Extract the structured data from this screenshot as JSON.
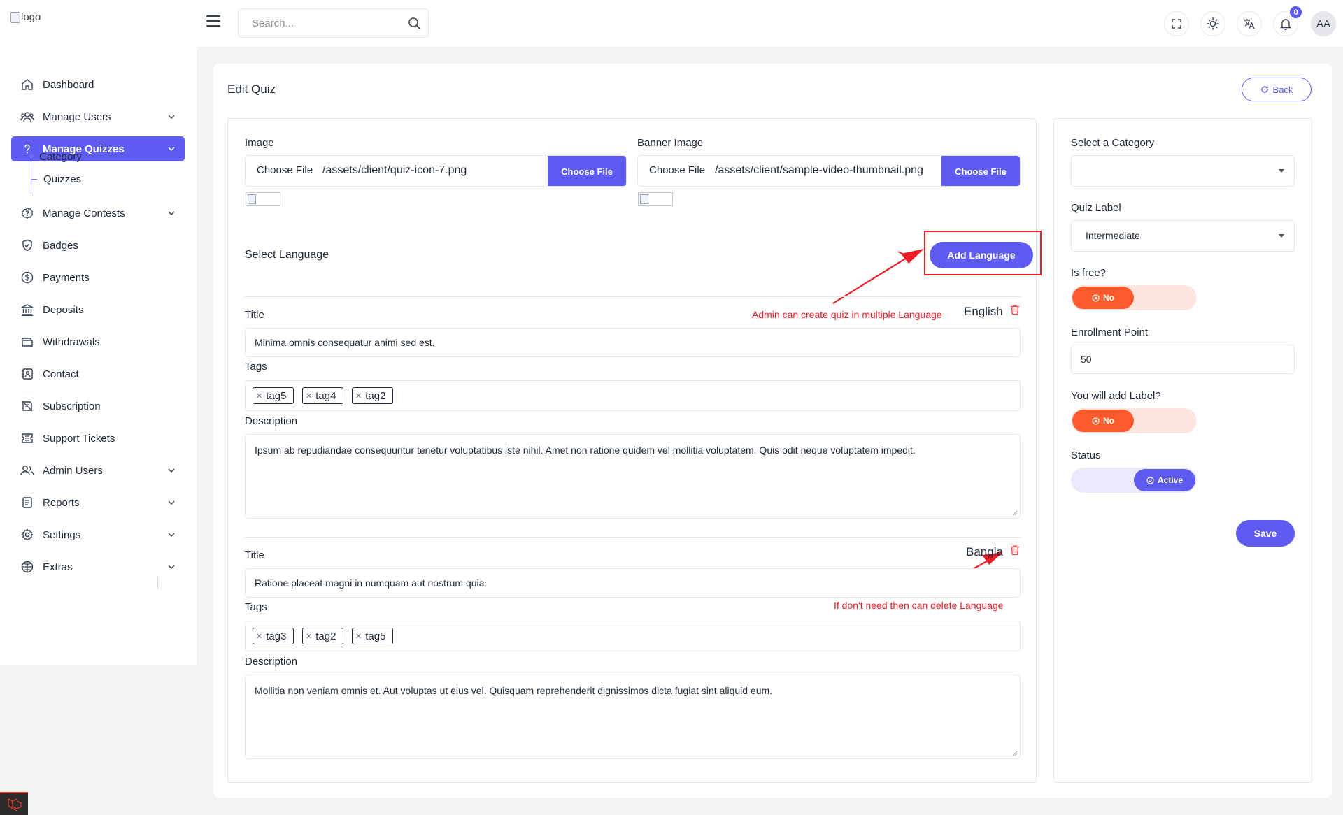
{
  "header": {
    "logo_alt": "logo",
    "search_placeholder": "Search...",
    "notification_count": "0",
    "avatar_initials": "AA"
  },
  "sidebar": {
    "items": [
      {
        "label": "Dashboard",
        "icon": "home-icon",
        "has_chevron": false
      },
      {
        "label": "Manage Users",
        "icon": "users-icon",
        "has_chevron": true
      },
      {
        "label": "Manage Quizzes",
        "icon": "question-icon",
        "has_chevron": true,
        "active": true
      },
      {
        "label": "Manage Contests",
        "icon": "contest-icon",
        "has_chevron": true
      },
      {
        "label": "Badges",
        "icon": "badge-icon",
        "has_chevron": false
      },
      {
        "label": "Payments",
        "icon": "dollar-icon",
        "has_chevron": false
      },
      {
        "label": "Deposits",
        "icon": "bank-icon",
        "has_chevron": false
      },
      {
        "label": "Withdrawals",
        "icon": "wallet-icon",
        "has_chevron": false
      },
      {
        "label": "Contact",
        "icon": "contact-icon",
        "has_chevron": false
      },
      {
        "label": "Subscription",
        "icon": "subscription-icon",
        "has_chevron": false
      },
      {
        "label": "Support Tickets",
        "icon": "ticket-icon",
        "has_chevron": false
      },
      {
        "label": "Admin Users",
        "icon": "admin-users-icon",
        "has_chevron": true
      },
      {
        "label": "Reports",
        "icon": "report-icon",
        "has_chevron": true
      },
      {
        "label": "Settings",
        "icon": "gear-icon",
        "has_chevron": true
      },
      {
        "label": "Extras",
        "icon": "extras-icon",
        "has_chevron": true
      }
    ],
    "subitems": [
      {
        "label": "Category"
      },
      {
        "label": "Quizzes"
      }
    ]
  },
  "page": {
    "title": "Edit Quiz",
    "back_label": "Back"
  },
  "form": {
    "image_label": "Image",
    "image_native_btn": "Choose File",
    "image_filename": "/assets/client/quiz-icon-7.png",
    "image_btn": "Choose File",
    "banner_label": "Banner Image",
    "banner_native_btn": "Choose File",
    "banner_filename": "/assets/client/sample-video-thumbnail.png",
    "banner_btn": "Choose File",
    "select_language_label": "Select Language",
    "add_language_label": "Add Language",
    "annotation_add": "Admin can create quiz in multiple Language",
    "annotation_delete": "If don't need then can delete Language",
    "languages": [
      {
        "name": "English",
        "title_label": "Title",
        "title_value": "Minima omnis consequatur animi sed est.",
        "tags_label": "Tags",
        "tags": [
          "tag5",
          "tag4",
          "tag2"
        ],
        "description_label": "Description",
        "description_value": "Ipsum ab repudiandae consequuntur tenetur voluptatibus iste nihil. Amet non ratione quidem vel mollitia voluptatem. Quis odit neque voluptatem impedit."
      },
      {
        "name": "Bangla",
        "title_label": "Title",
        "title_value": "Ratione placeat magni in numquam aut nostrum quia.",
        "tags_label": "Tags",
        "tags": [
          "tag3",
          "tag2",
          "tag5"
        ],
        "description_label": "Description",
        "description_value": "Mollitia non veniam omnis et. Aut voluptas ut eius vel. Quisquam reprehenderit dignissimos dicta fugiat sint aliquid eum."
      }
    ]
  },
  "settings_panel": {
    "category_label": "Select a Category",
    "category_value": "",
    "quiz_label_label": "Quiz Label",
    "quiz_label_value": "Intermediate",
    "is_free_label": "Is free?",
    "is_free_value": "No",
    "enrollment_label": "Enrollment Point",
    "enrollment_value": "50",
    "add_label_label": "You will add Label?",
    "add_label_value": "No",
    "status_label": "Status",
    "status_value": "Active",
    "save_label": "Save"
  },
  "colors": {
    "primary": "#5e5cf0",
    "toggle_off": "#ff5a2c",
    "annotation": "#ee1c25",
    "delete": "#ef4444"
  }
}
